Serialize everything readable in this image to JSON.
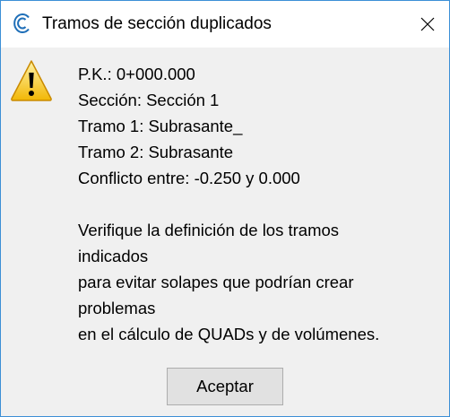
{
  "window": {
    "title": "Tramos de sección duplicados",
    "accent_color": "#3c8fd6"
  },
  "dialog": {
    "icon": "warning-icon",
    "lines": [
      "P.K.: 0+000.000",
      "Sección: Sección 1",
      "Tramo 1: Subrasante_",
      "Tramo 2: Subrasante",
      "Conflicto entre: -0.250 y 0.000"
    ],
    "message_lines": [
      "Verifique la definición de los tramos",
      "indicados",
      "para evitar solapes que podrían crear",
      "problemas",
      "en el cálculo de QUADs y de volúmenes."
    ],
    "ok_label": "Aceptar"
  }
}
